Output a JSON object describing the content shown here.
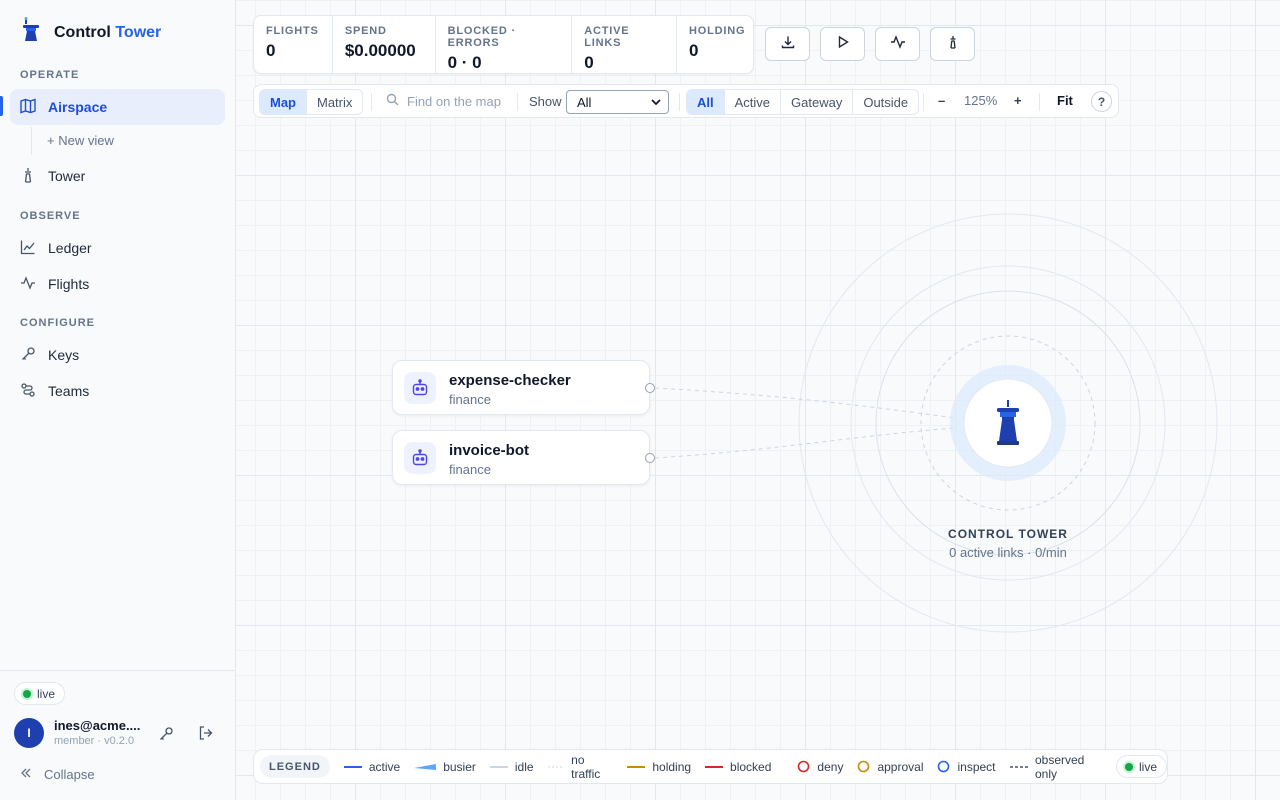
{
  "brand": {
    "name_main": "Control",
    "name_accent": "Tower"
  },
  "sidebar": {
    "sections": {
      "operate": "OPERATE",
      "observe": "OBSERVE",
      "configure": "CONFIGURE"
    },
    "items": {
      "airspace": "Airspace",
      "new_view": "+ New view",
      "tower": "Tower",
      "ledger": "Ledger",
      "flights": "Flights",
      "keys": "Keys",
      "teams": "Teams"
    },
    "footer": {
      "live": "live",
      "avatar_initial": "I",
      "user_email": "ines@acme....",
      "user_role": "member · v0.2.0",
      "collapse": "Collapse"
    }
  },
  "stats": [
    {
      "label": "FLIGHTS",
      "value": "0"
    },
    {
      "label": "SPEND",
      "value": "$0.00000"
    },
    {
      "label": "BLOCKED · ERRORS",
      "value": "0 · 0"
    },
    {
      "label": "ACTIVE LINKS",
      "value": "0"
    },
    {
      "label": "HOLDING",
      "value": "0"
    }
  ],
  "toolbar": {
    "views": [
      "Map",
      "Matrix"
    ],
    "active_view": "Map",
    "search_placeholder": "Find on the map",
    "show_label": "Show",
    "show_value": "All",
    "filters": [
      "All",
      "Active",
      "Gateway",
      "Outside"
    ],
    "active_filter": "All",
    "zoom_out": "–",
    "zoom": "125%",
    "zoom_in": "+",
    "fit": "Fit",
    "help": "?"
  },
  "agents": [
    {
      "name": "expense-checker",
      "team": "finance"
    },
    {
      "name": "invoice-bot",
      "team": "finance"
    }
  ],
  "tower": {
    "label": "CONTROL TOWER",
    "subtitle": "0 active links · 0/min"
  },
  "legend": {
    "title": "LEGEND",
    "items": [
      "active",
      "busier",
      "idle",
      "no traffic",
      "holding",
      "blocked",
      "deny",
      "approval",
      "inspect",
      "observed only"
    ],
    "live": "live"
  },
  "colors": {
    "accent": "#2563eb",
    "tower": "#1e40af",
    "live": "#16a34a",
    "holding": "#ca8a04",
    "blocked": "#dc2626"
  }
}
